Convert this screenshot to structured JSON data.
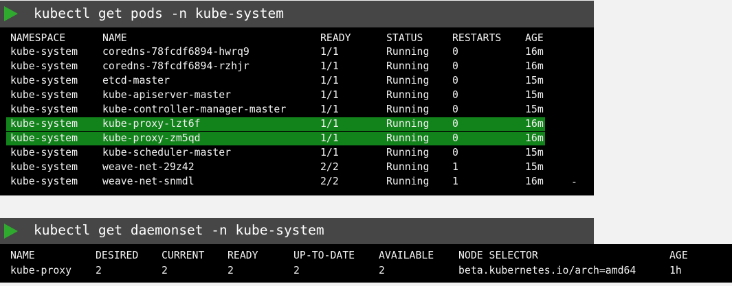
{
  "colors": {
    "page_bg": "#f2f2f2",
    "bar_bg": "#464646",
    "terminal_bg": "#000000",
    "highlight": "#12821b",
    "play_icon": "#2faa2f",
    "text": "#f2f2f2"
  },
  "icons": {
    "play": "play-triangle-icon"
  },
  "pods": {
    "command": "kubectl get pods -n kube-system",
    "headers": {
      "namespace": "NAMESPACE",
      "name": "NAME",
      "ready": "READY",
      "status": "STATUS",
      "restarts": "RESTARTS",
      "age": "AGE"
    },
    "rows": [
      {
        "namespace": "kube-system",
        "name": "coredns-78fcdf6894-hwrq9",
        "ready": "1/1",
        "status": "Running",
        "restarts": "0",
        "age": "16m",
        "highlighted": false
      },
      {
        "namespace": "kube-system",
        "name": "coredns-78fcdf6894-rzhjr",
        "ready": "1/1",
        "status": "Running",
        "restarts": "0",
        "age": "16m",
        "highlighted": false
      },
      {
        "namespace": "kube-system",
        "name": "etcd-master",
        "ready": "1/1",
        "status": "Running",
        "restarts": "0",
        "age": "15m",
        "highlighted": false
      },
      {
        "namespace": "kube-system",
        "name": "kube-apiserver-master",
        "ready": "1/1",
        "status": "Running",
        "restarts": "0",
        "age": "15m",
        "highlighted": false
      },
      {
        "namespace": "kube-system",
        "name": "kube-controller-manager-master",
        "ready": "1/1",
        "status": "Running",
        "restarts": "0",
        "age": "15m",
        "highlighted": false
      },
      {
        "namespace": "kube-system",
        "name": "kube-proxy-lzt6f",
        "ready": "1/1",
        "status": "Running",
        "restarts": "0",
        "age": "16m",
        "highlighted": true
      },
      {
        "namespace": "kube-system",
        "name": "kube-proxy-zm5qd",
        "ready": "1/1",
        "status": "Running",
        "restarts": "0",
        "age": "16m",
        "highlighted": true
      },
      {
        "namespace": "kube-system",
        "name": "kube-scheduler-master",
        "ready": "1/1",
        "status": "Running",
        "restarts": "0",
        "age": "15m",
        "highlighted": false
      },
      {
        "namespace": "kube-system",
        "name": "weave-net-29z42",
        "ready": "2/2",
        "status": "Running",
        "restarts": "1",
        "age": "15m",
        "highlighted": false
      },
      {
        "namespace": "kube-system",
        "name": "weave-net-snmdl",
        "ready": "2/2",
        "status": "Running",
        "restarts": "1",
        "age": "16m",
        "highlighted": false
      }
    ],
    "trailing_mark": "-"
  },
  "daemonset": {
    "command": "kubectl get daemonset -n kube-system",
    "headers": {
      "name": "NAME",
      "desired": "DESIRED",
      "current": "CURRENT",
      "ready": "READY",
      "up_to_date": "UP-TO-DATE",
      "available": "AVAILABLE",
      "node_selector": "NODE SELECTOR",
      "age": "AGE"
    },
    "rows": [
      {
        "name": "kube-proxy",
        "desired": "2",
        "current": "2",
        "ready": "2",
        "up_to_date": "2",
        "available": "2",
        "node_selector": "beta.kubernetes.io/arch=amd64",
        "age": "1h"
      }
    ]
  }
}
